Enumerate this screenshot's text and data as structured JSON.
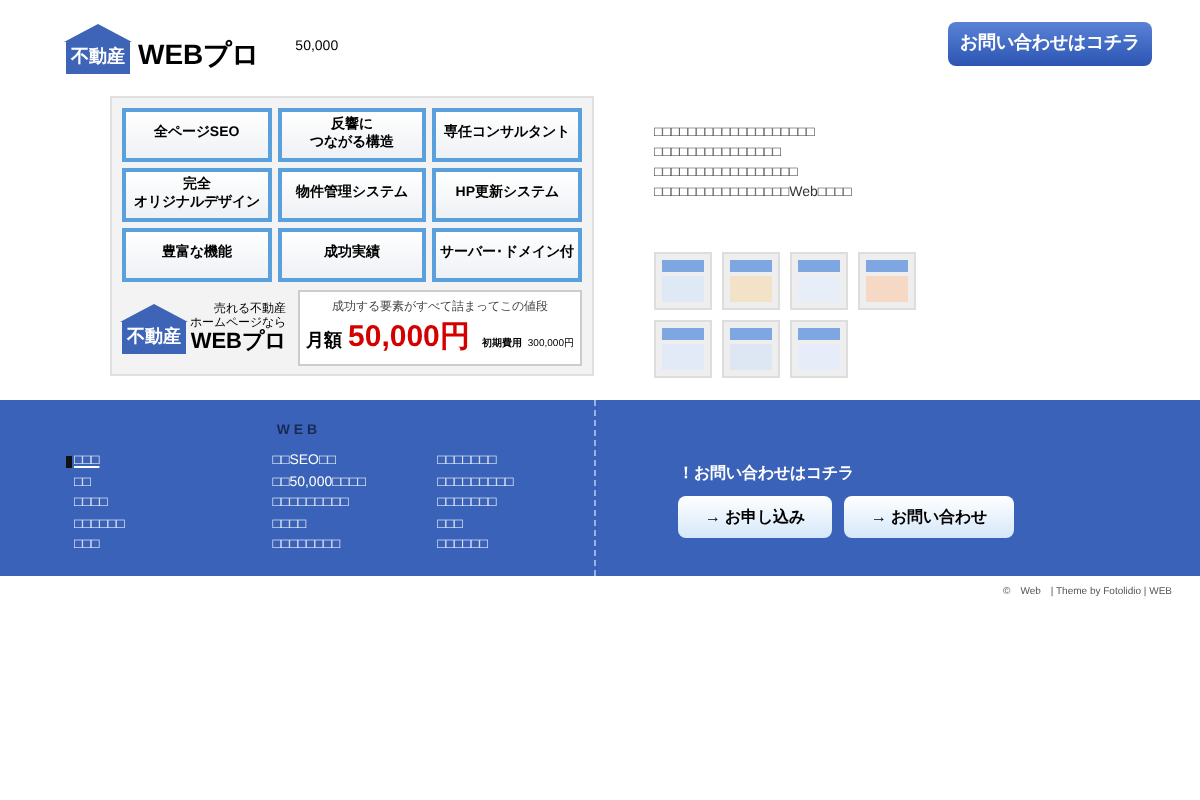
{
  "header": {
    "logo_badge": "不動産",
    "logo_text": "WEBプロ",
    "price": "50,000",
    "contact_button": "お問い合わせはコチラ"
  },
  "banner": {
    "features": [
      [
        "全ページSEO"
      ],
      [
        "反響に",
        "つながる構造"
      ],
      [
        "専任コンサルタント"
      ],
      [
        "完全",
        "オリジナルデザイン"
      ],
      [
        "物件管理システム"
      ],
      [
        "HP更新システム"
      ],
      [
        "豊富な機能"
      ],
      [
        "成功実績"
      ],
      [
        "サーバー･ドメイン付"
      ]
    ],
    "logo_badge": "不動産",
    "logo_tagline": [
      "売れる不動産",
      "ホームページなら"
    ],
    "logo_text": "WEBプロ",
    "price_heading": "成功する要素がすべて詰まってこの値段",
    "price_label": "月額",
    "price_value": "50,000円",
    "initial_label": "初期費用",
    "initial_value": "300,000円"
  },
  "description": [
    "□□□□□□□□□□□□□□□□□□□",
    "□□□□□□□□□□□□□□□",
    "□□□□□□□□□□□□□□□□□",
    "□□□□□□□□□□□□□□□□Web□□□□"
  ],
  "footer_nav": {
    "title": "W E B",
    "columns": [
      [
        {
          "label": "□□□",
          "selected": true
        },
        {
          "label": "□□",
          "selected": false
        },
        {
          "label": "□□□□",
          "selected": false
        },
        {
          "label": "□□□□□□",
          "selected": false
        },
        {
          "label": "□□□",
          "selected": false
        }
      ],
      [
        {
          "label": "□□SEO□□",
          "selected": false
        },
        {
          "label": "□□50,000□□□□",
          "selected": false
        },
        {
          "label": "□□□□□□□□□",
          "selected": false
        },
        {
          "label": "□□□□",
          "selected": false
        },
        {
          "label": "□□□□□□□□",
          "selected": false
        }
      ],
      [
        {
          "label": "□□□□□□□",
          "selected": false
        },
        {
          "label": "□□□□□□□□□",
          "selected": false
        },
        {
          "label": "□□□□□□□",
          "selected": false
        },
        {
          "label": "□□□",
          "selected": false
        },
        {
          "label": "□□□□□□",
          "selected": false
        }
      ]
    ]
  },
  "contact": {
    "heading": "！お問い合わせはコチラ",
    "buttons": [
      "→ お申し込み",
      "→ お問い合わせ"
    ]
  },
  "copyright": "©　Web　| Theme by Fotolidio | WEB"
}
